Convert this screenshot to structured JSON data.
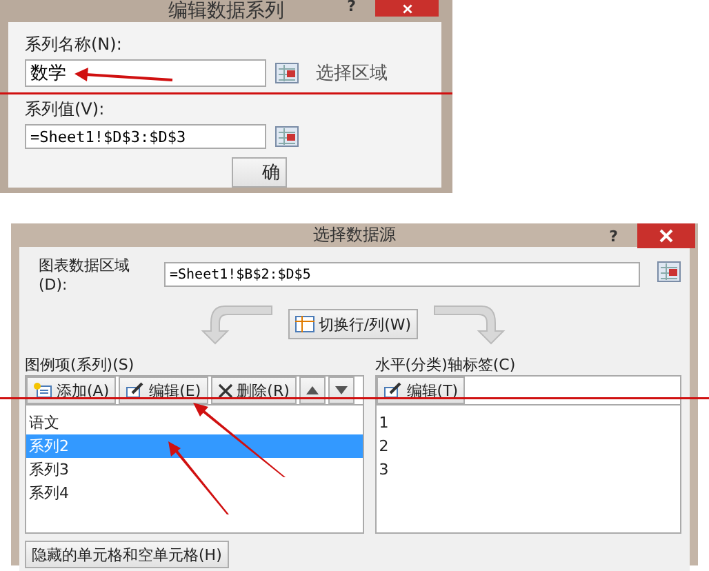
{
  "edit_series_dialog": {
    "title": "编辑数据系列",
    "help": "?",
    "name_label": "系列名称(N):",
    "name_value": "数学",
    "select_range_hint": "选择区域",
    "values_label": "系列值(V):",
    "values_value": "=Sheet1!$D$3:$D$3",
    "ok_button": "确"
  },
  "select_source_dialog": {
    "title": "选择数据源",
    "help": "?",
    "range_label": "图表数据区域(D):",
    "range_value": "=Sheet1!$B$2:$D$5",
    "switch_button": "切换行/列(W)",
    "legend": {
      "label": "图例项(系列)(S)",
      "toolbar": [
        {
          "kind": "add",
          "label": "添加(A)"
        },
        {
          "kind": "edit",
          "label": "编辑(E)"
        },
        {
          "kind": "delete",
          "label": "删除(R)"
        },
        {
          "kind": "up"
        },
        {
          "kind": "down"
        }
      ],
      "items": [
        {
          "label": "语文",
          "selected": false
        },
        {
          "label": "系列2",
          "selected": true
        },
        {
          "label": "系列3",
          "selected": false
        },
        {
          "label": "系列4",
          "selected": false
        }
      ]
    },
    "axis": {
      "label": "水平(分类)轴标签(C)",
      "edit_button": "编辑(T)",
      "items": [
        "1",
        "2",
        "3"
      ]
    },
    "hidden_cells_button": "隐藏的单元格和空单元格(H)"
  }
}
